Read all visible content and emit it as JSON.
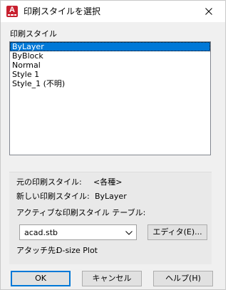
{
  "window": {
    "title": "印刷スタイルを選択",
    "icon": "autocad-app-icon",
    "icon_letter": "A",
    "accent_color": "#c8202f"
  },
  "styles_section": {
    "label": "印刷スタイル",
    "items": [
      {
        "label": "ByLayer",
        "selected": true
      },
      {
        "label": "ByBlock",
        "selected": false
      },
      {
        "label": "Normal",
        "selected": false
      },
      {
        "label": "Style 1",
        "selected": false
      },
      {
        "label": "Style_1 (不明)",
        "selected": false
      }
    ]
  },
  "info": {
    "original_label": "元の印刷スタイル:",
    "original_value": "<各種>",
    "new_label": "新しい印刷スタイル:",
    "new_value": "ByLayer",
    "active_table_label": "アクティブな印刷スタイル テーブル:",
    "table_value": "acad.stb",
    "editor_button": "エディタ(E)...",
    "attached_label": "アタッチ先:",
    "attached_value": "D-size Plot"
  },
  "buttons": {
    "ok": "OK",
    "cancel": "キャンセル",
    "help": "ヘルプ(H)"
  },
  "colors": {
    "selection": "#0078d7",
    "dialog_bg": "#f0f0f0"
  }
}
